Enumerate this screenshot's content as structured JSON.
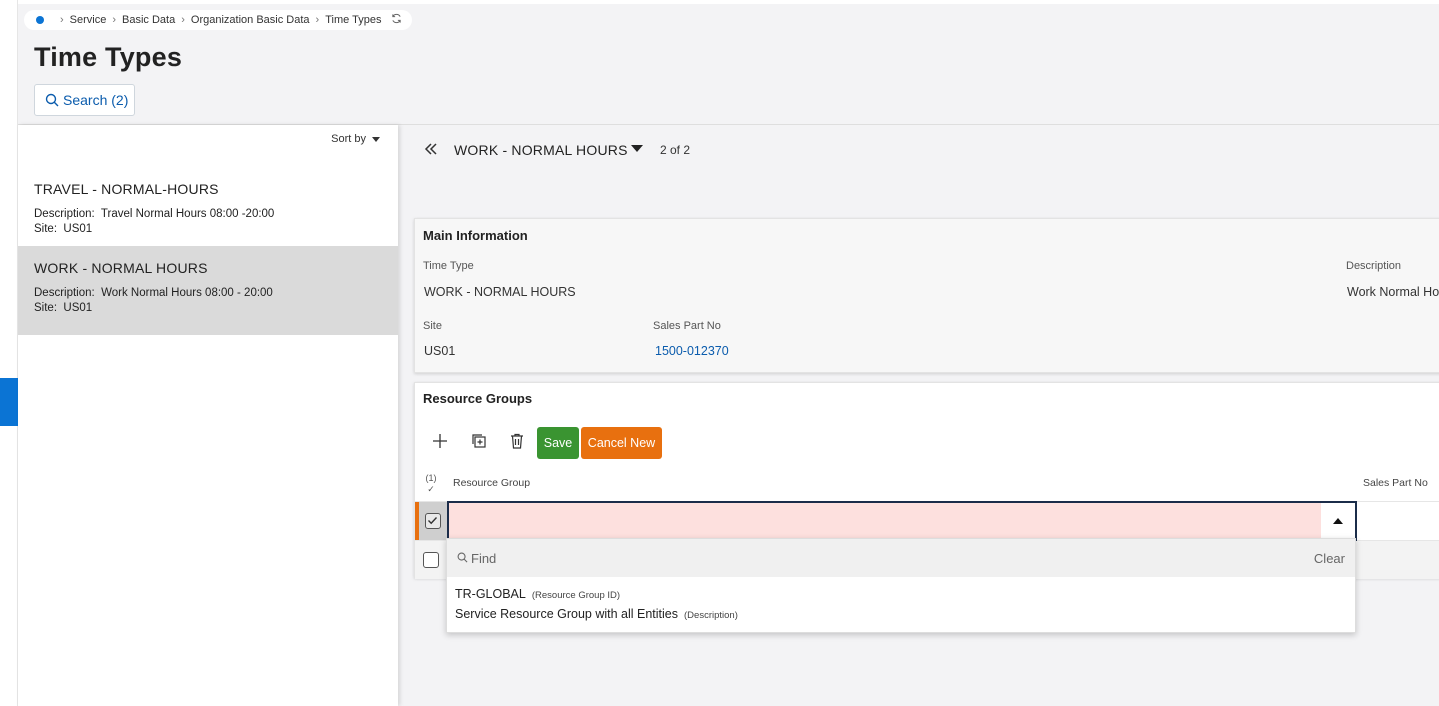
{
  "breadcrumb": {
    "items": [
      "Service",
      "Basic Data",
      "Organization Basic Data",
      "Time Types"
    ]
  },
  "page": {
    "title": "Time Types",
    "search_label": "Search (2)"
  },
  "list": {
    "sort_label": "Sort by",
    "items": [
      {
        "title": "TRAVEL - NORMAL-HOURS",
        "description_label": "Description:",
        "description": "Travel Normal Hours 08:00 -20:00",
        "site_label": "Site:",
        "site": "US01",
        "selected": false
      },
      {
        "title": "WORK - NORMAL HOURS",
        "description_label": "Description:",
        "description": "Work Normal Hours 08:00 - 20:00",
        "site_label": "Site:",
        "site": "US01",
        "selected": true
      }
    ]
  },
  "record_header": {
    "title": "WORK - NORMAL HOURS",
    "count": "2 of 2"
  },
  "main_info": {
    "title": "Main Information",
    "time_type_label": "Time Type",
    "time_type_value": "WORK - NORMAL HOURS",
    "description_label": "Description",
    "description_value": "Work Normal Ho",
    "site_label": "Site",
    "site_value": "US01",
    "sales_part_label": "Sales Part No",
    "sales_part_value": "1500-012370"
  },
  "resource_groups": {
    "title": "Resource Groups",
    "save_label": "Save",
    "cancel_new_label": "Cancel New",
    "selected_count": "(1)",
    "col_resource_group": "Resource Group",
    "col_sales_part_no": "Sales Part No"
  },
  "dropdown": {
    "find_placeholder": "Find",
    "clear_label": "Clear",
    "option_id": "TR-GLOBAL",
    "option_id_hint": "(Resource Group ID)",
    "option_desc": "Service Resource Group with all Entities",
    "option_desc_hint": "(Description)"
  },
  "colors": {
    "accent": "#0b74d4",
    "save": "#3a9431",
    "cancel": "#e8700f",
    "invalid_field": "#fde0de"
  }
}
